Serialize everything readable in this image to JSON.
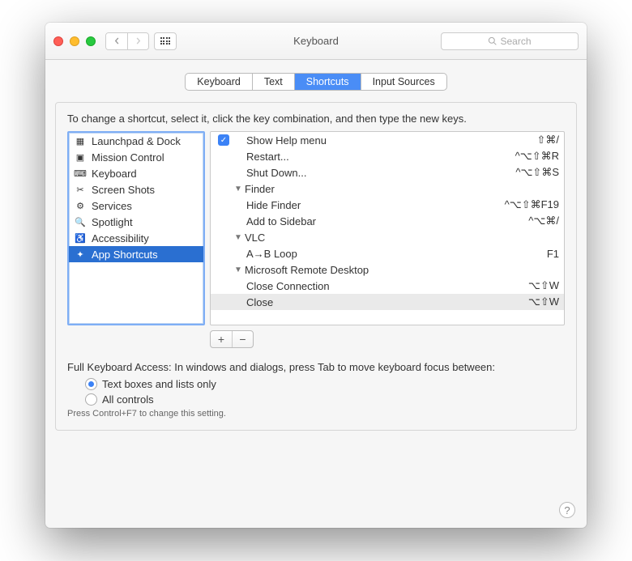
{
  "titlebar": {
    "title": "Keyboard",
    "search_placeholder": "Search"
  },
  "tabs": {
    "items": [
      {
        "label": "Keyboard"
      },
      {
        "label": "Text"
      },
      {
        "label": "Shortcuts",
        "selected": true
      },
      {
        "label": "Input Sources"
      }
    ]
  },
  "panel": {
    "instruction": "To change a shortcut, select it, click the key combination, and then type the new keys.",
    "sidebar": {
      "items": [
        {
          "label": "Launchpad & Dock",
          "icon": "launchpad"
        },
        {
          "label": "Mission Control",
          "icon": "mission-control"
        },
        {
          "label": "Keyboard",
          "icon": "keyboard"
        },
        {
          "label": "Screen Shots",
          "icon": "screenshot"
        },
        {
          "label": "Services",
          "icon": "services"
        },
        {
          "label": "Spotlight",
          "icon": "spotlight"
        },
        {
          "label": "Accessibility",
          "icon": "accessibility"
        },
        {
          "label": "App Shortcuts",
          "icon": "apps",
          "selected": true
        }
      ]
    },
    "shortcuts": [
      {
        "kind": "item",
        "label": "Show Help menu",
        "combo": "⇧⌘/",
        "checked": true,
        "indent": 0
      },
      {
        "kind": "item",
        "label": "Restart...",
        "combo": "^⌥⇧⌘R",
        "indent": 0
      },
      {
        "kind": "item",
        "label": "Shut Down...",
        "combo": "^⌥⇧⌘S",
        "indent": 0
      },
      {
        "kind": "group",
        "label": "Finder"
      },
      {
        "kind": "item",
        "label": "Hide Finder",
        "combo": "^⌥⇧⌘F19",
        "indent": 1
      },
      {
        "kind": "item",
        "label": "Add to Sidebar",
        "combo": "^⌥⌘/",
        "indent": 1
      },
      {
        "kind": "group",
        "label": "VLC"
      },
      {
        "kind": "item",
        "label": "A→B Loop",
        "combo": "F1",
        "indent": 1
      },
      {
        "kind": "group",
        "label": "Microsoft Remote Desktop"
      },
      {
        "kind": "item",
        "label": "Close Connection",
        "combo": "⌥⇧W",
        "indent": 1
      },
      {
        "kind": "item",
        "label": "Close",
        "combo": "⌥⇧W",
        "indent": 1,
        "selected": true
      }
    ],
    "buttons": {
      "plus": "+",
      "minus": "−"
    }
  },
  "keyboard_access": {
    "prompt": "Full Keyboard Access: In windows and dialogs, press Tab to move keyboard focus between:",
    "options": [
      {
        "label": "Text boxes and lists only",
        "selected": true
      },
      {
        "label": "All controls"
      }
    ],
    "hint": "Press Control+F7 to change this setting."
  },
  "help": {
    "label": "?"
  }
}
